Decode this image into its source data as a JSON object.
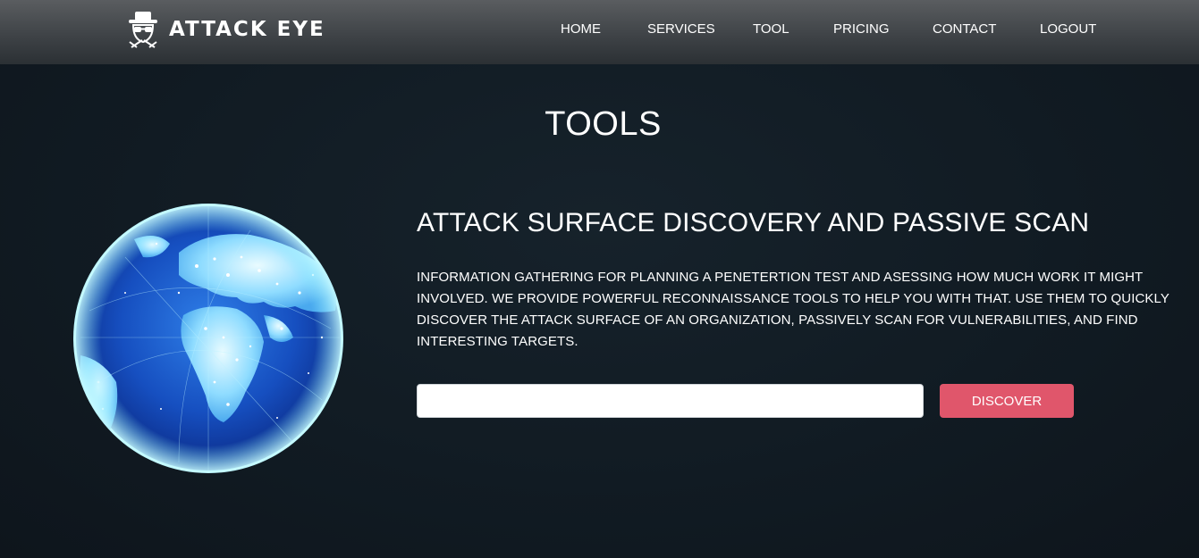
{
  "brand": {
    "name": "ATTACK EYE",
    "icon": "spy-hat-glasses-icon"
  },
  "nav": {
    "items": [
      {
        "label": "HOME"
      },
      {
        "label": "SERVICES"
      },
      {
        "label": "TOOL"
      },
      {
        "label": "PRICING"
      },
      {
        "label": "CONTACT"
      },
      {
        "label": "LOGOUT"
      }
    ]
  },
  "main": {
    "title": "TOOLS",
    "heading": "ATTACK SURFACE DISCOVERY AND PASSIVE SCAN",
    "description": "INFORMATION GATHERING FOR PLANNING A PENETERTION TEST AND ASESSING HOW MUCH WORK IT MIGHT INVOLVED. WE PROVIDE POWERFUL RECONNAISSANCE TOOLS TO HELP YOU WITH THAT. USE THEM TO QUICKLY DISCOVER THE ATTACK SURFACE OF AN ORGANIZATION, PASSIVELY SCAN FOR VULNERABILITIES, AND FIND INTERESTING TARGETS.",
    "input": {
      "value": "",
      "placeholder": ""
    },
    "button_label": "DISCOVER"
  },
  "colors": {
    "background": "#111a22",
    "navbar": "#45494d",
    "accent": "#e0566b",
    "text": "#ffffff"
  }
}
